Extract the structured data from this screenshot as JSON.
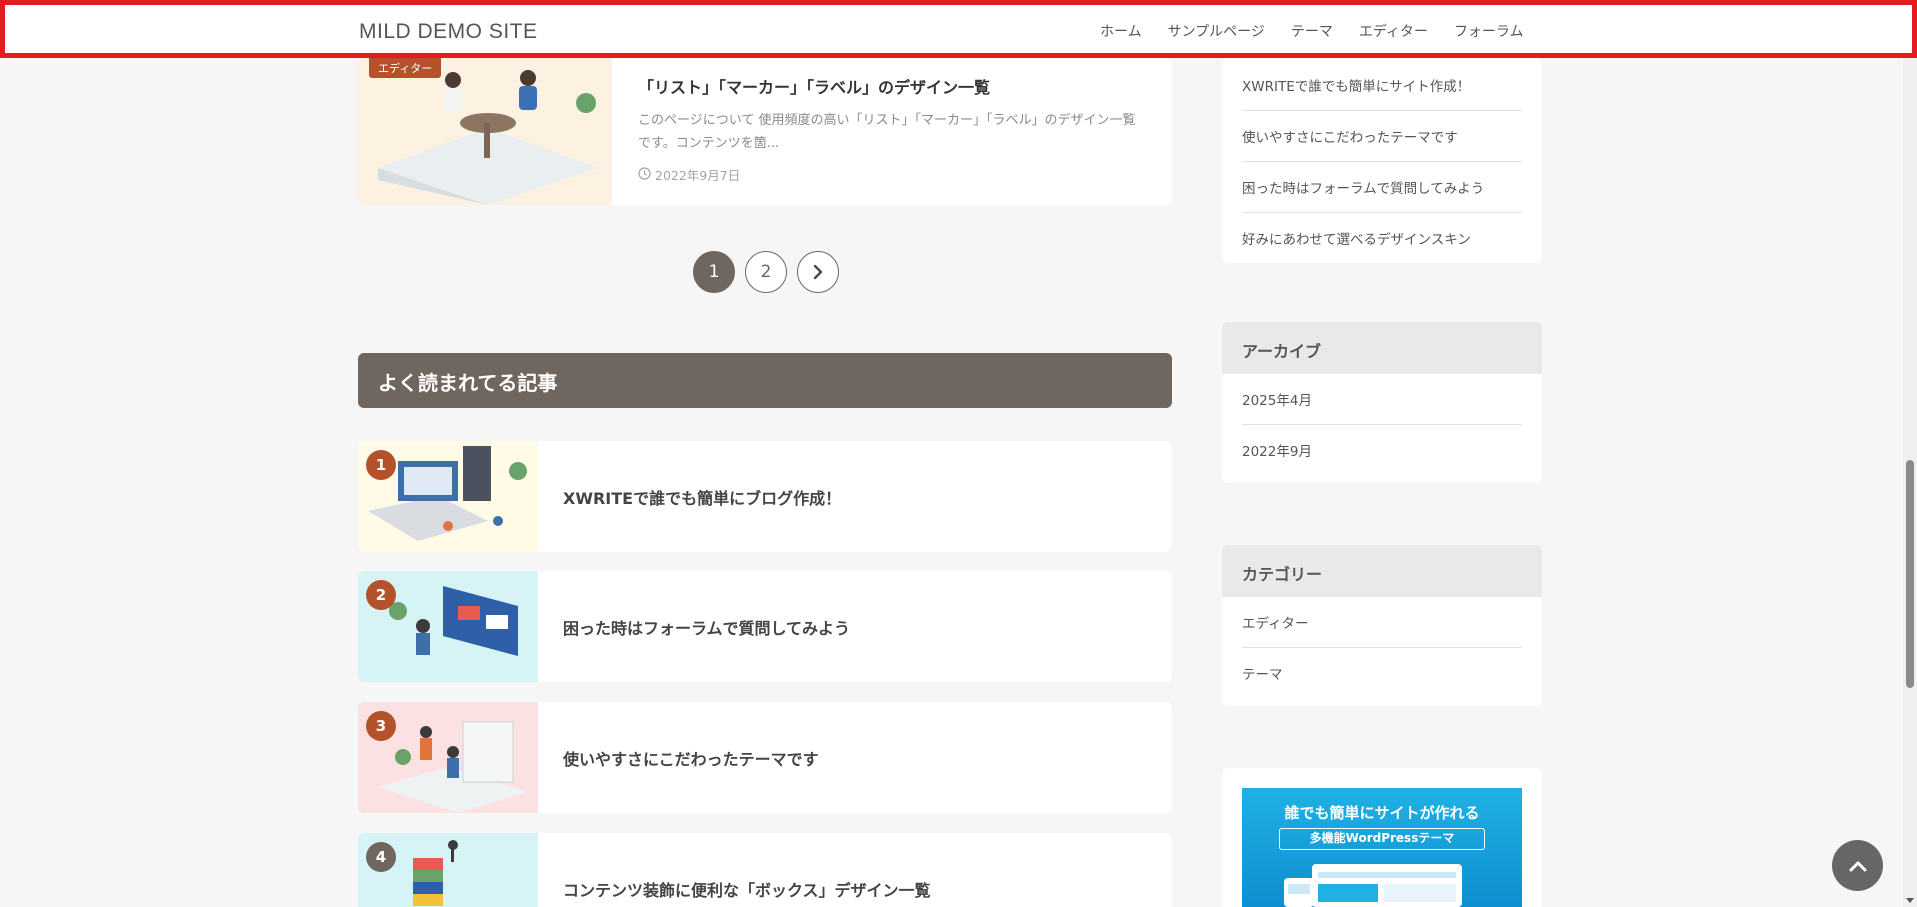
{
  "header": {
    "site_title": "MILD DEMO SITE",
    "nav": [
      "ホーム",
      "サンプルページ",
      "テーマ",
      "エディター",
      "フォーラム"
    ]
  },
  "post_card": {
    "category": "エディター",
    "title": "「リスト」「マーカー」「ラベル」のデザイン一覧",
    "excerpt": "このページについて 使用頻度の高い「リスト」「マーカー」「ラベル」のデザイン一覧です。コンテンツを箇...",
    "date": "2022年9月7日"
  },
  "pagination": {
    "pages": [
      "1",
      "2"
    ],
    "current": "1"
  },
  "popular": {
    "heading": "よく読まれてる記事",
    "items": [
      {
        "rank": "1",
        "title": "XWRITEで誰でも簡単にブログ作成！"
      },
      {
        "rank": "2",
        "title": "困った時はフォーラムで質問してみよう"
      },
      {
        "rank": "3",
        "title": "使いやすさにこだわったテーマです"
      },
      {
        "rank": "4",
        "title": "コンテンツ装飾に便利な「ボックス」デザイン一覧"
      }
    ]
  },
  "sidebar": {
    "recent": [
      "XWRITEで誰でも簡単にサイト作成！",
      "使いやすさにこだわったテーマです",
      "困った時はフォーラムで質問してみよう",
      "好みにあわせて選べるデザインスキン"
    ],
    "archive": {
      "heading": "アーカイブ",
      "items": [
        "2025年4月",
        "2022年9月"
      ]
    },
    "category": {
      "heading": "カテゴリー",
      "items": [
        "エディター",
        "テーマ"
      ]
    },
    "banner": {
      "line1": "誰でも簡単にサイトが作れる",
      "line2": "多機能WordPressテーマ"
    }
  },
  "colors": {
    "accent": "#6f6660",
    "badge": "#b4532b",
    "highlight_border": "#e31b23"
  }
}
